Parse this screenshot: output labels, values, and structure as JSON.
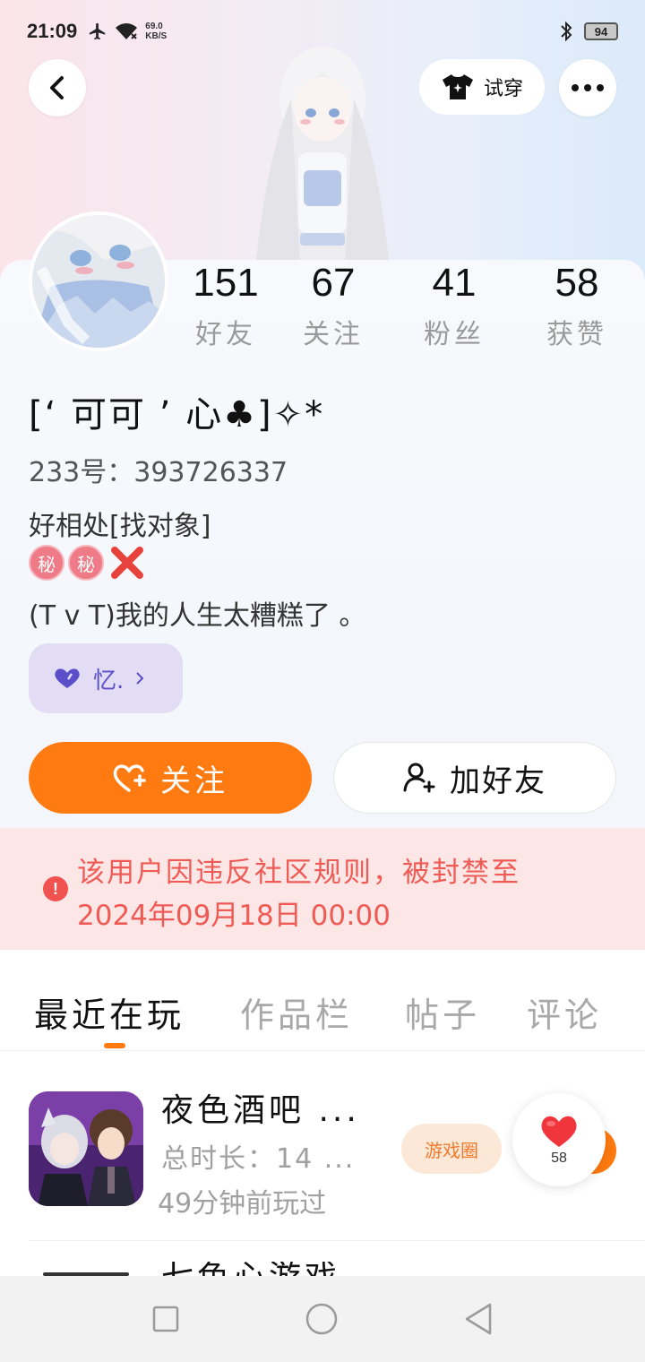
{
  "status_bar": {
    "time": "21:09",
    "net_speed_value": "69.0",
    "net_speed_unit": "KB/S",
    "battery": "94"
  },
  "header": {
    "back_icon": "chevron-left-icon",
    "try_on_label": "试穿",
    "more_icon": "more-horizontal-icon"
  },
  "profile": {
    "stats": [
      {
        "value": "151",
        "label": "好友"
      },
      {
        "value": "67",
        "label": "关注"
      },
      {
        "value": "41",
        "label": "粉丝"
      },
      {
        "value": "58",
        "label": "获赞"
      }
    ],
    "nickname": "[‘ 可可 ’ 心♣]✧*",
    "uid": "233号：393726337",
    "bio_line1": "好相处[找对象]",
    "bio_badge1": "秘",
    "bio_badge2": "秘",
    "bio_line3": "(T v T)我的人生太糟糕了 。",
    "tag_label": "忆.",
    "follow_label": "关注",
    "add_friend_label": "加好友"
  },
  "ban_notice": {
    "line1": "该用户因违反社区规则，被封禁至",
    "line2": "2024年09月18日 00:00"
  },
  "tabs": [
    {
      "label": "最近在玩",
      "active": true
    },
    {
      "label": "作品栏",
      "active": false
    },
    {
      "label": "帖子",
      "active": false
    },
    {
      "label": "评论",
      "active": false
    }
  ],
  "recent_games": [
    {
      "title": "夜色酒吧 ...",
      "total_time": "总时长：14 ...",
      "last_played": "49分钟前玩过",
      "circle_label": "游戏圈"
    }
  ],
  "next_row_title": "七色心游戏",
  "like_float": {
    "count": "58"
  },
  "colors": {
    "accent_orange": "#ff7a10",
    "ban_red": "#ef5a55",
    "tag_purple": "#5a4fc8"
  }
}
